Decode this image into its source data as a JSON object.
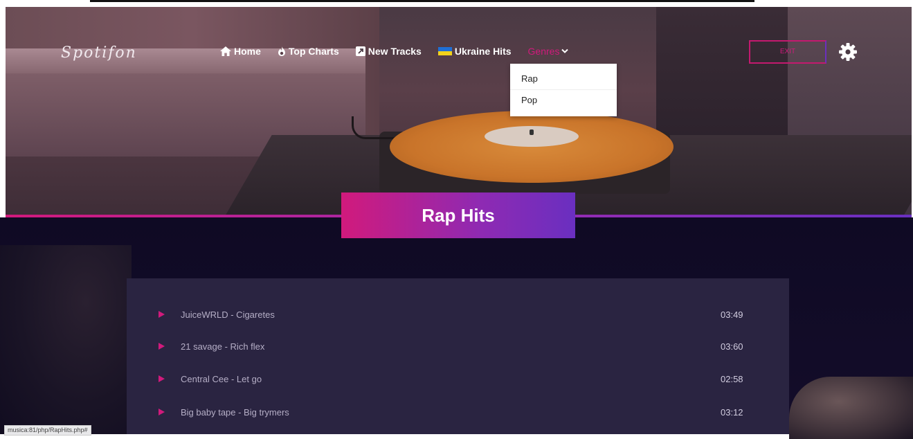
{
  "brand": {
    "logo": "Spotifon"
  },
  "nav": {
    "items": [
      {
        "label": "Home",
        "icon": "home-icon"
      },
      {
        "label": "Top Charts",
        "icon": "fire-icon"
      },
      {
        "label": "New Tracks",
        "icon": "new-arrow-icon"
      },
      {
        "label": "Ukraine Hits",
        "icon": "ukraine-flag-icon"
      }
    ],
    "genres": {
      "label": "Genres",
      "options": [
        "Rap",
        "Pop"
      ]
    }
  },
  "header": {
    "exit_label": "EXIT",
    "settings_icon": "gear-icon"
  },
  "page": {
    "title": "Rap Hits"
  },
  "tracks": [
    {
      "title": "JuiceWRLD - Cigaretes",
      "duration": "03:49"
    },
    {
      "title": "21 savage - Rich flex",
      "duration": "03:60"
    },
    {
      "title": "Central Cee - Let go",
      "duration": "02:58"
    },
    {
      "title": "Big baby tape - Big trymers",
      "duration": "03:12"
    }
  ],
  "status": {
    "url": "musica:81/php/RapHits.php#"
  },
  "colors": {
    "accent": "#d11a7c",
    "accent2": "#6a2fc0",
    "dark_bg": "#0f0a24",
    "panel": "#2a2441"
  }
}
